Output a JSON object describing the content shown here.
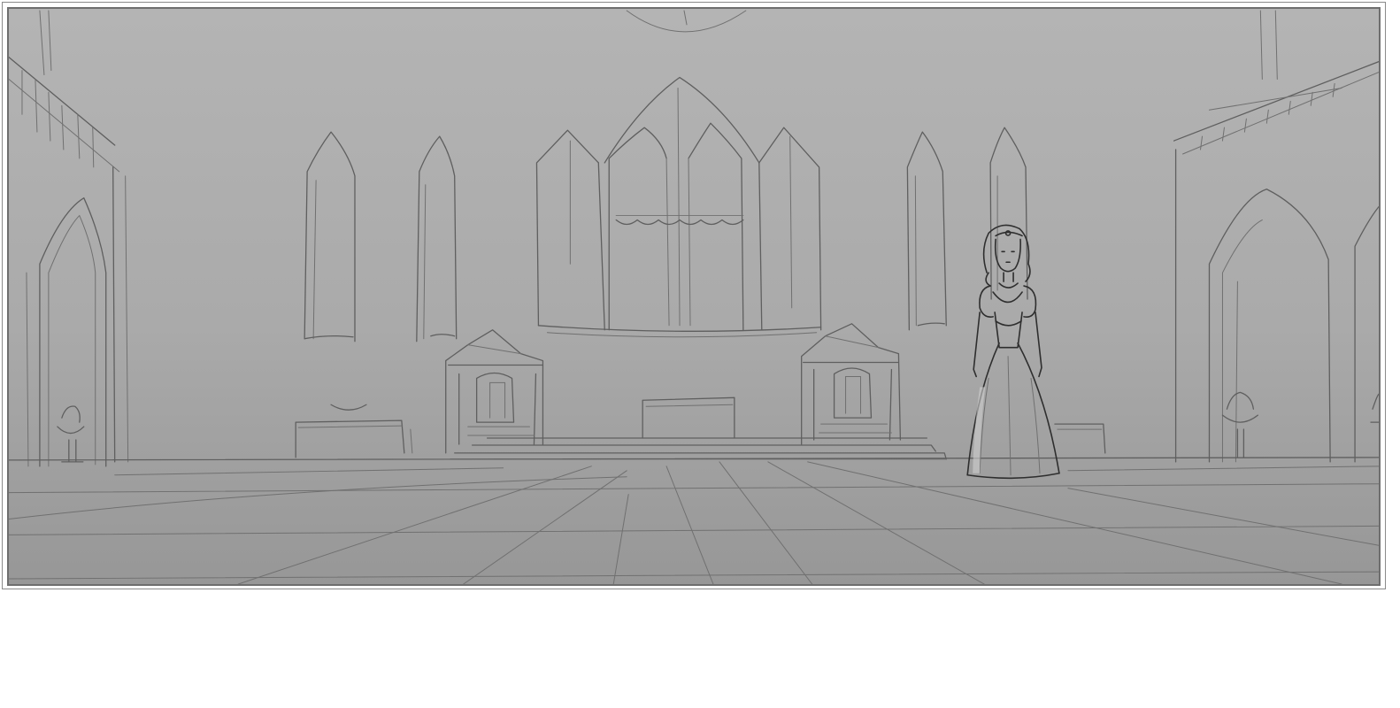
{
  "panel": {
    "background_top": "#b4b4b4",
    "background_bottom": "#969696",
    "line_color": "#5f5f5f",
    "figure_line_color": "#2e2e2e"
  }
}
